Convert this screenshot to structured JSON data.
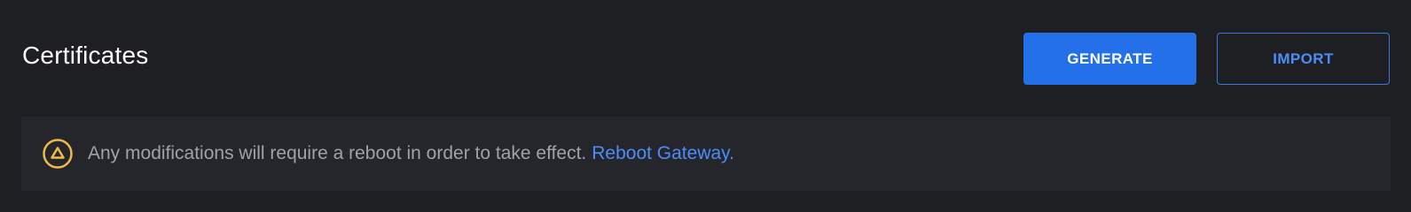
{
  "header": {
    "title": "Certificates",
    "generate_label": "GENERATE",
    "import_label": "IMPORT"
  },
  "banner": {
    "icon": "warning-triangle-icon",
    "message": "Any modifications will require a reboot in order to take effect.",
    "link_label": "Reboot Gateway."
  },
  "colors": {
    "background": "#1e1f22",
    "accent": "#2370e8",
    "link": "#4c8dfa",
    "warning": "#f2b84b",
    "banner_bg": "#25262b"
  }
}
